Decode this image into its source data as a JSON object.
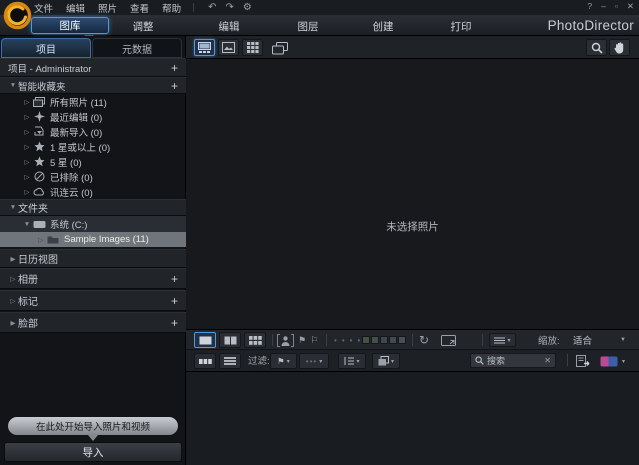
{
  "app": {
    "title": "PhotoDirector"
  },
  "titlebar": {
    "menus": [
      {
        "label": "文件"
      },
      {
        "label": "编辑"
      },
      {
        "label": "照片"
      },
      {
        "label": "查看"
      },
      {
        "label": "帮助"
      }
    ],
    "window": {
      "help": "?",
      "minimize": "–",
      "maximize": "▫",
      "close": "✕"
    }
  },
  "mode_tabs": {
    "items": [
      {
        "label": "图库",
        "active": true
      },
      {
        "label": "调整",
        "active": false
      },
      {
        "label": "编辑",
        "active": false
      },
      {
        "label": "图层",
        "active": false
      },
      {
        "label": "创建",
        "active": false
      },
      {
        "label": "打印",
        "active": false
      }
    ]
  },
  "sidebar": {
    "tabs": [
      {
        "label": "项目",
        "active": true
      },
      {
        "label": "元数据",
        "active": false
      }
    ],
    "project_header": {
      "label": "项目 - Administrator"
    },
    "smart": {
      "label": "智能收藏夹",
      "items": [
        {
          "label": "所有照片 (11)"
        },
        {
          "label": "最近编辑 (0)"
        },
        {
          "label": "最新导入 (0)"
        },
        {
          "label": "1 星或以上 (0)"
        },
        {
          "label": "5 星 (0)"
        },
        {
          "label": "已排除 (0)"
        },
        {
          "label": "讯连云 (0)"
        }
      ]
    },
    "folders": {
      "label": "文件夹",
      "drive": "系统 (C:)",
      "selected_folder": "Sample Images (11)"
    },
    "calendar": {
      "label": "日历视图"
    },
    "albums": {
      "label": "相册"
    },
    "tags": {
      "label": "标记"
    },
    "faces": {
      "label": "脸部"
    },
    "import_hint": "在此处开始导入照片和视频",
    "import_button": "导入"
  },
  "viewer": {
    "empty_text": "未选择照片"
  },
  "status_bar": {
    "zoom_label": "缩放:",
    "zoom_value": "适合"
  },
  "filter_bar": {
    "label": "过滤:",
    "search_placeholder": "搜索"
  },
  "colors": {
    "accent": "#4a9ae0",
    "label_colors": [
      "#465044",
      "#415048",
      "#3f464d",
      "#444951",
      "#4a4e56"
    ]
  },
  "icons": {
    "collapse": "▼",
    "expand": "▶",
    "expand_item": "▷",
    "add": "+",
    "undo": "↶",
    "redo": "↷",
    "gear": "⚙",
    "flag": "⚑",
    "flag_reject": "⚐",
    "dot": "•",
    "rotate": "↻",
    "clear": "✕",
    "dropdown": "▼",
    "dropdown_small": "▾"
  }
}
